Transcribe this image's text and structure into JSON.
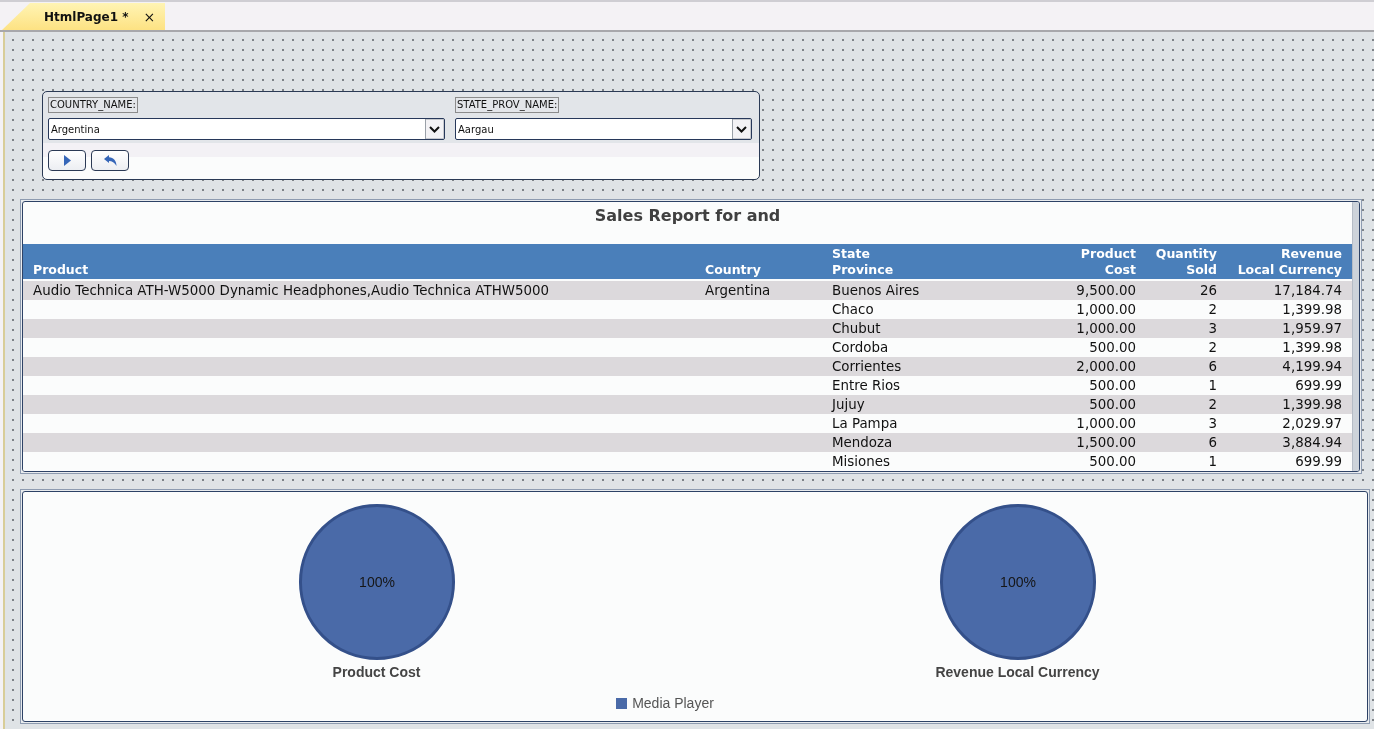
{
  "tabs": [
    {
      "label": "HtmlPage1 *",
      "selected": true,
      "close": "×"
    }
  ],
  "filter_panel": {
    "fields": [
      {
        "label": "COUNTRY_NAME:",
        "value": "Argentina"
      },
      {
        "label": "STATE_PROV_NAME:",
        "value": "Aargau"
      }
    ],
    "buttons": [
      {
        "kind": "run"
      },
      {
        "kind": "reset"
      }
    ]
  },
  "report": {
    "title": "Sales Report for and",
    "columns": [
      {
        "label": "Product",
        "kind": "text"
      },
      {
        "label": "Country",
        "kind": "text"
      },
      {
        "label": "State\nProvince",
        "kind": "text"
      },
      {
        "label": "Product\nCost",
        "kind": "number"
      },
      {
        "label": "Quantity\nSold",
        "kind": "number"
      },
      {
        "label": "Revenue\nLocal Currency",
        "kind": "number"
      }
    ],
    "rows": [
      {
        "product": "Audio Technica ATH-W5000 Dynamic Headphones,Audio Technica ATHW5000",
        "country": "Argentina",
        "state_province": "Buenos Aires",
        "product_cost": "9,500.00",
        "quantity_sold": "26",
        "revenue_local_currency": "17,184.74"
      },
      {
        "state_province": "Chaco",
        "product_cost": "1,000.00",
        "quantity_sold": "2",
        "revenue_local_currency": "1,399.98"
      },
      {
        "state_province": "Chubut",
        "product_cost": "1,000.00",
        "quantity_sold": "3",
        "revenue_local_currency": "1,959.97"
      },
      {
        "state_province": "Cordoba",
        "product_cost": "500.00",
        "quantity_sold": "2",
        "revenue_local_currency": "1,399.98"
      },
      {
        "state_province": "Corrientes",
        "product_cost": "2,000.00",
        "quantity_sold": "6",
        "revenue_local_currency": "4,199.94"
      },
      {
        "state_province": "Entre Rios",
        "product_cost": "500.00",
        "quantity_sold": "1",
        "revenue_local_currency": "699.99"
      },
      {
        "state_province": "Jujuy",
        "product_cost": "500.00",
        "quantity_sold": "2",
        "revenue_local_currency": "1,399.98"
      },
      {
        "state_province": "La Pampa",
        "product_cost": "1,000.00",
        "quantity_sold": "3",
        "revenue_local_currency": "2,029.97"
      },
      {
        "state_province": "Mendoza",
        "product_cost": "1,500.00",
        "quantity_sold": "6",
        "revenue_local_currency": "3,884.94"
      },
      {
        "state_province": "Misiones",
        "product_cost": "500.00",
        "quantity_sold": "1",
        "revenue_local_currency": "699.99"
      }
    ]
  },
  "chart_panel": {
    "charts": [
      {
        "chart_data": {
          "type": "pie",
          "title": "Product Cost",
          "values": [
            100
          ],
          "value_labels": [
            "100%"
          ]
        }
      },
      {
        "chart_data": {
          "type": "pie",
          "title": "Revenue Local Currency",
          "values": [
            100
          ],
          "value_labels": [
            "100%"
          ]
        }
      }
    ],
    "legend": [
      {
        "label": "Media Player",
        "color": "#4a6aa8"
      }
    ]
  }
}
